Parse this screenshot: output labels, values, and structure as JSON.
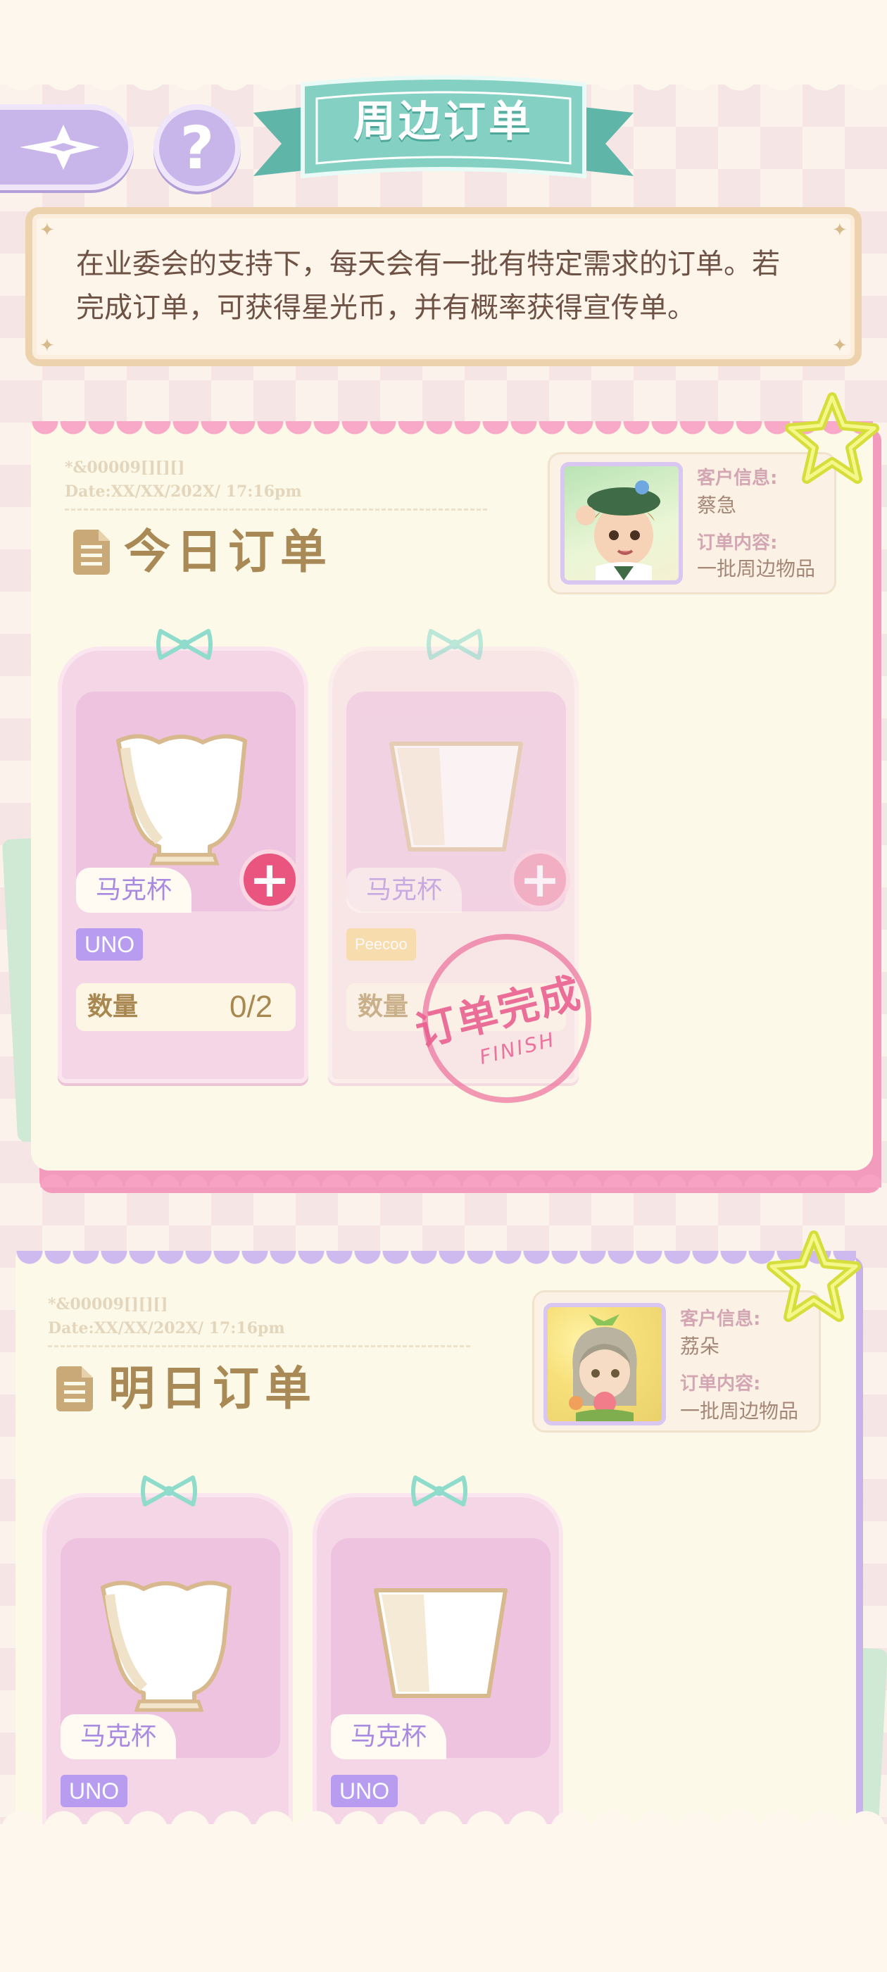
{
  "header": {
    "title": "周边订单",
    "help_symbol": "?"
  },
  "notice": {
    "text_line1": "在业委会的支持下，每天会有一批有特定需求的订单。若",
    "text_line2": "完成订单，可获得星光币，并有概率获得宣传单。"
  },
  "today": {
    "serial": "*&00009[][][]",
    "date": "Date:XX/XX/202X/ 17:16pm",
    "title": "今日订单",
    "client_info_label": "客户信息:",
    "client_name": "蔡急",
    "order_content_label": "订单内容:",
    "order_content": "一批周边物品",
    "items": [
      {
        "name": "马克杯",
        "brand": "UNO",
        "brand_color": "#b79cf0",
        "qty_label": "数量",
        "qty": "0/2",
        "completed": false
      },
      {
        "name": "马克杯",
        "brand": "Peecoo",
        "brand_color": "#f7dba0",
        "qty_label": "数量",
        "qty": "",
        "completed": true
      }
    ],
    "stamp_text": "订单完成",
    "stamp_sub": "FINISH"
  },
  "tomorrow": {
    "serial": "*&00009[][][]",
    "date": "Date:XX/XX/202X/ 17:16pm",
    "title": "明日订单",
    "client_info_label": "客户信息:",
    "client_name": "荔朵",
    "order_content_label": "订单内容:",
    "order_content": "一批周边物品",
    "items": [
      {
        "name": "马克杯",
        "brand": "UNO",
        "brand_color": "#b79cf0"
      },
      {
        "name": "马克杯",
        "brand": "UNO",
        "brand_color": "#b79cf0"
      }
    ]
  },
  "colors": {
    "accent_pink": "#f39bbd",
    "accent_purple": "#c9b2ea",
    "ribbon_teal": "#7dcabd",
    "plus_button": "#e9557f"
  },
  "icons": [
    "back-arrow-icon",
    "help-icon",
    "document-icon",
    "star-icon",
    "bow-icon",
    "plus-icon",
    "tulip-cup-icon",
    "tumbler-cup-icon"
  ]
}
